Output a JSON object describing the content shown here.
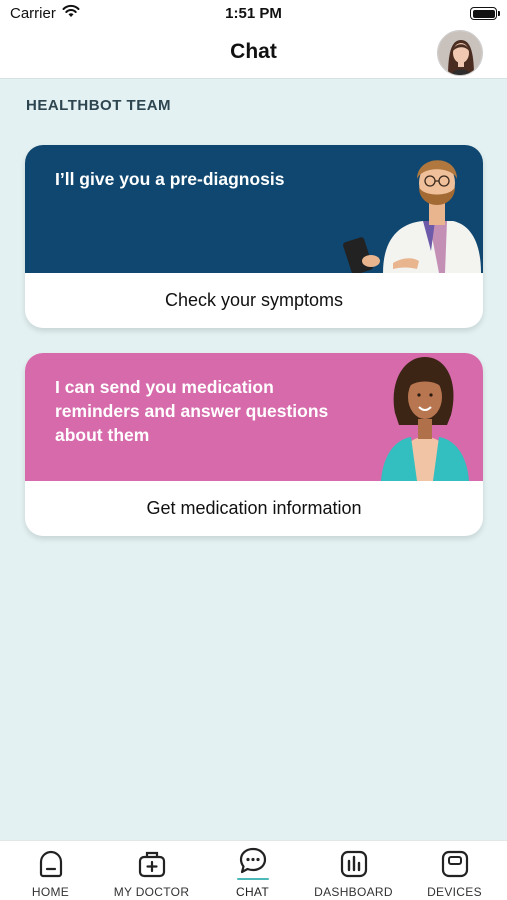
{
  "status_bar": {
    "carrier": "Carrier",
    "time": "1:51 PM"
  },
  "header": {
    "title": "Chat"
  },
  "section": {
    "title": "HEALTHBOT TEAM"
  },
  "cards": [
    {
      "message": "I’ll give you a pre-diagnosis",
      "action": "Check your symptoms",
      "color": "#0f4770"
    },
    {
      "message": "I can send you medication reminders and answer questions about them",
      "action": "Get medication information",
      "color": "#d66aab"
    }
  ],
  "tab_bar": {
    "items": [
      {
        "label": "HOME",
        "icon": "home-icon"
      },
      {
        "label": "MY DOCTOR",
        "icon": "medical-bag-icon"
      },
      {
        "label": "CHAT",
        "icon": "chat-icon",
        "active": true
      },
      {
        "label": "DASHBOARD",
        "icon": "bar-chart-icon"
      },
      {
        "label": "DEVICES",
        "icon": "device-icon"
      }
    ],
    "accent": "#4db8b8"
  }
}
